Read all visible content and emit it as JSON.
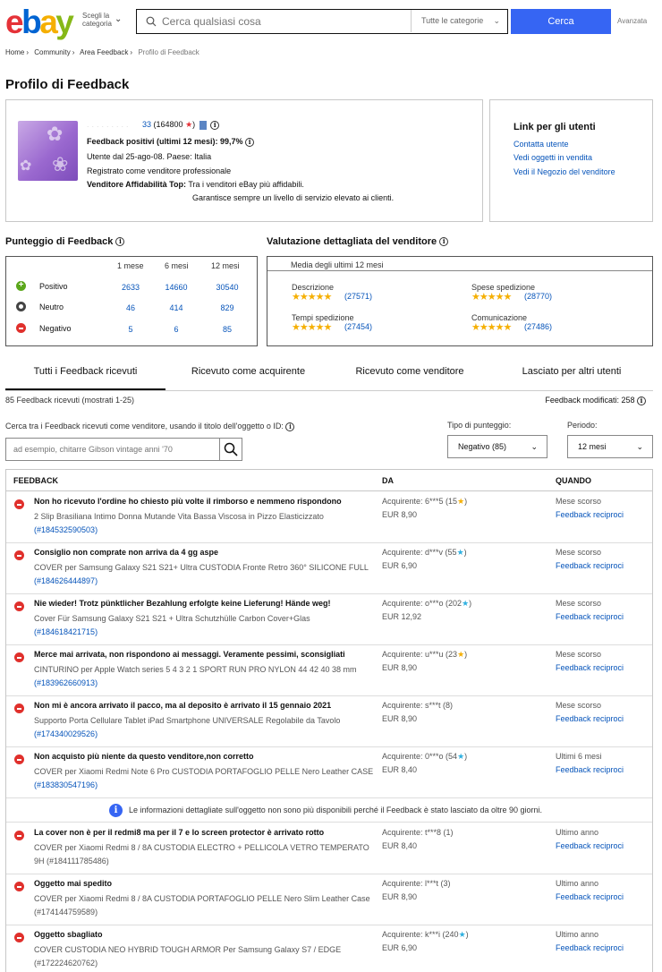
{
  "header": {
    "logo": {
      "e": "e",
      "b": "b",
      "a": "a",
      "y": "y"
    },
    "shop_by_category": "Scegli la categoria",
    "search_placeholder": "Cerca qualsiasi cosa",
    "category_select": "Tutte le categorie",
    "search_button": "Cerca",
    "advanced": "Avanzata"
  },
  "breadcrumb": [
    "Home",
    "Community",
    "Area Feedback",
    "Profilo di Feedback"
  ],
  "page_title": "Profilo di Feedback",
  "profile": {
    "username_masked": ".........",
    "username_suffix": "33",
    "score": "(164800",
    "star": "★",
    "close_paren": ")",
    "positive_label": "Feedback positivi (ultimi 12 mesi): 99,7%",
    "member_since": "Utente dal 25-ago-08. Paese: Italia",
    "registered": "Registrato come venditore professionale",
    "top_rated_label": "Venditore Affidabilità Top:",
    "top_rated_text": "Tra i venditori eBay più affidabili.",
    "top_rated_text2": "Garantisce sempre un livello di servizio elevato ai clienti."
  },
  "user_links": {
    "title": "Link per gli utenti",
    "items": [
      "Contatta utente",
      "Vedi oggetti in vendita",
      "Vedi il Negozio del venditore"
    ]
  },
  "feedback_score": {
    "title": "Punteggio di Feedback",
    "columns": [
      "1 mese",
      "6 mesi",
      "12 mesi"
    ],
    "rows": [
      {
        "label": "Positivo",
        "values": [
          "2633",
          "14660",
          "30540"
        ]
      },
      {
        "label": "Neutro",
        "values": [
          "46",
          "414",
          "829"
        ]
      },
      {
        "label": "Negativo",
        "values": [
          "5",
          "6",
          "85"
        ]
      }
    ]
  },
  "dsr": {
    "title": "Valutazione dettagliata del venditore",
    "subtitle": "Media degli ultimi 12 mesi",
    "items": [
      {
        "label": "Descrizione",
        "stars": "★★★★★",
        "count": "(27571)"
      },
      {
        "label": "Spese spedizione",
        "stars": "★★★★★",
        "count": "(28770)"
      },
      {
        "label": "Tempi spedizione",
        "stars": "★★★★★",
        "count": "(27454)"
      },
      {
        "label": "Comunicazione",
        "stars": "★★★★★",
        "count": "(27486)"
      }
    ]
  },
  "tabs": [
    "Tutti i Feedback ricevuti",
    "Ricevuto come acquirente",
    "Ricevuto come venditore",
    "Lasciato per altri utenti"
  ],
  "results_count": "85 Feedback ricevuti (mostrati 1-25)",
  "modified": "Feedback modificati: 258",
  "filter": {
    "label": "Cerca tra i Feedback ricevuti come venditore, usando il titolo dell'oggetto o ID:",
    "placeholder": "ad esempio, chitarre Gibson vintage anni '70",
    "rating_type_label": "Tipo di punteggio:",
    "rating_type_value": "Negativo (85)",
    "period_label": "Periodo:",
    "period_value": "12 mesi"
  },
  "table": {
    "headers": [
      "FEEDBACK",
      "DA",
      "QUANDO"
    ],
    "rows": [
      {
        "title": "Non ho ricevuto l'ordine ho chiesto più volte il rimborso e nemmeno rispondono",
        "item": "2 Slip Brasiliana Intimo Donna Mutande Vita Bassa Viscosa in Pizzo Elasticizzato",
        "item_id": "(#184532590503)",
        "buyer": "Acquirente: 6***5 (15",
        "buyer_star": "★",
        "star_color": "yellow",
        "price": "EUR 8,90",
        "when": "Mese scorso",
        "link": "Feedback reciproci"
      },
      {
        "title": "Consiglio non comprate non arriva da 4 gg aspe",
        "item": "COVER per Samsung Galaxy S21 S21+ Ultra CUSTODIA Fronte Retro 360° SILICONE FULL",
        "item_id": "(#184626444897)",
        "buyer": "Acquirente: d***v (55",
        "buyer_star": "★",
        "star_color": "blue",
        "price": "EUR 6,90",
        "when": "Mese scorso",
        "link": "Feedback reciproci"
      },
      {
        "title": "Nie wieder! Trotz pünktlicher Bezahlung erfolgte keine Lieferung! Hände weg!",
        "item": "Cover Für Samsung Galaxy S21 S21 + Ultra Schutzhülle Carbon Cover+Glas",
        "item_id": "(#184618421715)",
        "buyer": "Acquirente: o***o (202",
        "buyer_star": "★",
        "star_color": "blue",
        "price": "EUR 12,92",
        "when": "Mese scorso",
        "link": "Feedback reciproci"
      },
      {
        "title": "Merce mai arrivata, non rispondono ai messaggi. Veramente pessimi, sconsigliati",
        "item": "CINTURINO per Apple Watch series 5 4 3 2 1 SPORT RUN PRO NYLON 44 42 40 38 mm",
        "item_id": "(#183962660913)",
        "buyer": "Acquirente: u***u (23",
        "buyer_star": "★",
        "star_color": "yellow",
        "price": "EUR 8,90",
        "when": "Mese scorso",
        "link": "Feedback reciproci"
      },
      {
        "title": "Non mi è ancora arrivato il pacco, ma al deposito è arrivato il 15 gennaio 2021",
        "item": "Supporto Porta Cellulare Tablet iPad Smartphone UNIVERSALE Regolabile da Tavolo",
        "item_id": "(#174340029526)",
        "buyer": "Acquirente: s***t (8",
        "buyer_star": "",
        "star_color": "none",
        "price": "EUR 8,90",
        "when": "Mese scorso",
        "link": "Feedback reciproci"
      },
      {
        "title": "Non acquisto più niente da questo venditore,non corretto",
        "item": "COVER per Xiaomi Redmi Note 6 Pro CUSTODIA PORTAFOGLIO PELLE Nero Leather CASE",
        "item_id": "(#183830547196)",
        "buyer": "Acquirente: 0***o (54",
        "buyer_star": "★",
        "star_color": "blue",
        "price": "EUR 8,40",
        "when": "Ultimi 6 mesi",
        "link": "Feedback reciproci"
      },
      {
        "title": "La cover non è per il redmi8 ma per il 7 e lo screen protector è arrivato rotto",
        "item": "COVER per Xiaomi Redmi 8 / 8A CUSTODIA ELECTRO + PELLICOLA VETRO TEMPERATO 9H",
        "item_id": "(#184111785486)",
        "buyer": "Acquirente: t***8 (1",
        "buyer_star": "",
        "star_color": "none",
        "price": "EUR 8,40",
        "when": "Ultimo anno",
        "link": "Feedback reciproci"
      },
      {
        "title": "Oggetto mai spedito",
        "item": "COVER per Xiaomi Redmi 8 / 8A CUSTODIA PORTAFOGLIO PELLE Nero Slim Leather Case",
        "item_id": "(#174144759589)",
        "buyer": "Acquirente: l***t (3",
        "buyer_star": "",
        "star_color": "none",
        "price": "EUR 8,90",
        "when": "Ultimo anno",
        "link": "Feedback reciproci"
      },
      {
        "title": "Oggetto sbagliato",
        "item": "COVER CUSTODIA NEO HYBRID TOUGH ARMOR Per Samsung Galaxy S7 / EDGE",
        "item_id": "(#172224620762)",
        "buyer": "Acquirente: k***i (240",
        "buyer_star": "★",
        "star_color": "blue",
        "price": "EUR 6,90",
        "when": "Ultimo anno",
        "link": "Feedback reciproci"
      }
    ],
    "notice": "Le informazioni dettagliate sull'oggetto non sono più disponibili perché il Feedback è stato lasciato da oltre 90 giorni."
  }
}
